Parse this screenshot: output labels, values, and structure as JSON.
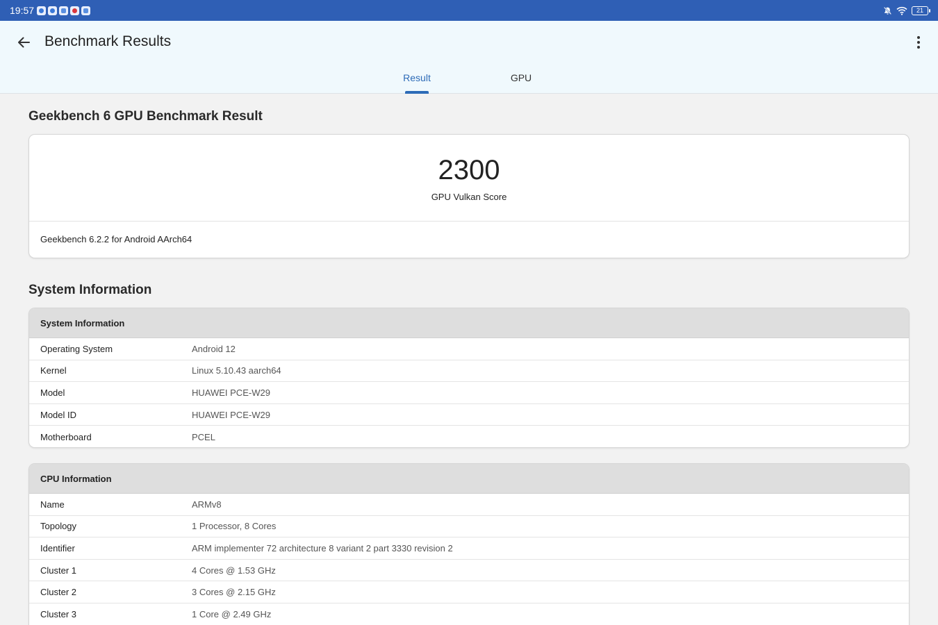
{
  "status_bar": {
    "time": "19:57",
    "battery": "21"
  },
  "app_bar": {
    "title": "Benchmark Results"
  },
  "tabs": [
    {
      "label": "Result",
      "active": true
    },
    {
      "label": "GPU",
      "active": false
    }
  ],
  "result": {
    "section_title": "Geekbench 6 GPU Benchmark Result",
    "score": "2300",
    "score_label": "GPU Vulkan Score",
    "version": "Geekbench 6.2.2 for Android AArch64"
  },
  "system_section": {
    "title": "System Information",
    "system_card": {
      "header": "System Information",
      "rows": [
        {
          "key": "Operating System",
          "value": "Android 12"
        },
        {
          "key": "Kernel",
          "value": "Linux 5.10.43 aarch64"
        },
        {
          "key": "Model",
          "value": "HUAWEI PCE-W29"
        },
        {
          "key": "Model ID",
          "value": "HUAWEI PCE-W29"
        },
        {
          "key": "Motherboard",
          "value": "PCEL"
        }
      ]
    },
    "cpu_card": {
      "header": "CPU Information",
      "rows": [
        {
          "key": "Name",
          "value": "ARMv8"
        },
        {
          "key": "Topology",
          "value": "1 Processor, 8 Cores"
        },
        {
          "key": "Identifier",
          "value": "ARM implementer 72 architecture 8 variant 2 part 3330 revision 2"
        },
        {
          "key": "Cluster 1",
          "value": "4 Cores @ 1.53 GHz"
        },
        {
          "key": "Cluster 2",
          "value": "3 Cores @ 2.15 GHz"
        },
        {
          "key": "Cluster 3",
          "value": "1 Core @ 2.49 GHz"
        }
      ]
    }
  },
  "colors": {
    "status_bar": "#2f5fb5",
    "app_bar": "#f0f9fd",
    "accent": "#2d6bb7",
    "card_header": "#dedede"
  },
  "icons": {
    "back": "arrow-left-icon",
    "more": "more-vert-icon",
    "mute": "bell-off-icon",
    "wifi": "wifi-icon",
    "battery": "battery-icon"
  }
}
